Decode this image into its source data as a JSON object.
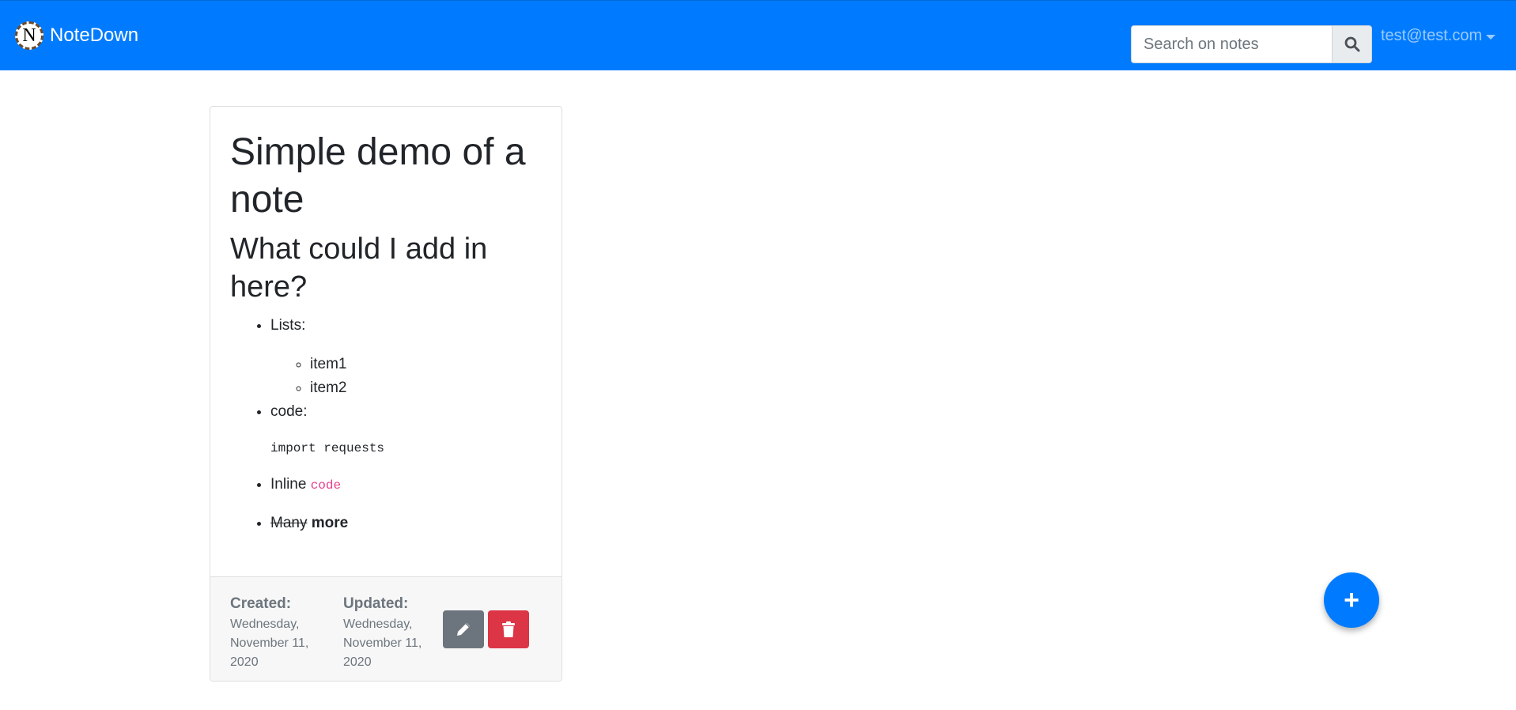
{
  "navbar": {
    "logo_letter": "N",
    "brand": "NoteDown",
    "search_placeholder": "Search on notes",
    "user_email": "test@test.com"
  },
  "note": {
    "title": "Simple demo of a note",
    "subtitle": "What could I add in here?",
    "list": {
      "lists_label": "Lists:",
      "sub_items": [
        "item1",
        "item2"
      ],
      "code_label": "code:",
      "code_block": "import requests",
      "inline_prefix": "Inline ",
      "inline_code": "code",
      "strike_text": "Many",
      "bold_text": "more"
    },
    "created_label": "Created:",
    "created_date": "Wednesday, November 11, 2020",
    "updated_label": "Updated:",
    "updated_date": "Wednesday, November 11, 2020"
  },
  "fab": {
    "label": "+"
  },
  "colors": {
    "primary": "#007bff",
    "secondary": "#6c757d",
    "danger": "#dc3545",
    "inline_code": "#e83e8c"
  },
  "icons": {
    "search": "search-icon",
    "edit": "pencil-icon",
    "delete": "trash-icon",
    "add": "plus-icon"
  }
}
